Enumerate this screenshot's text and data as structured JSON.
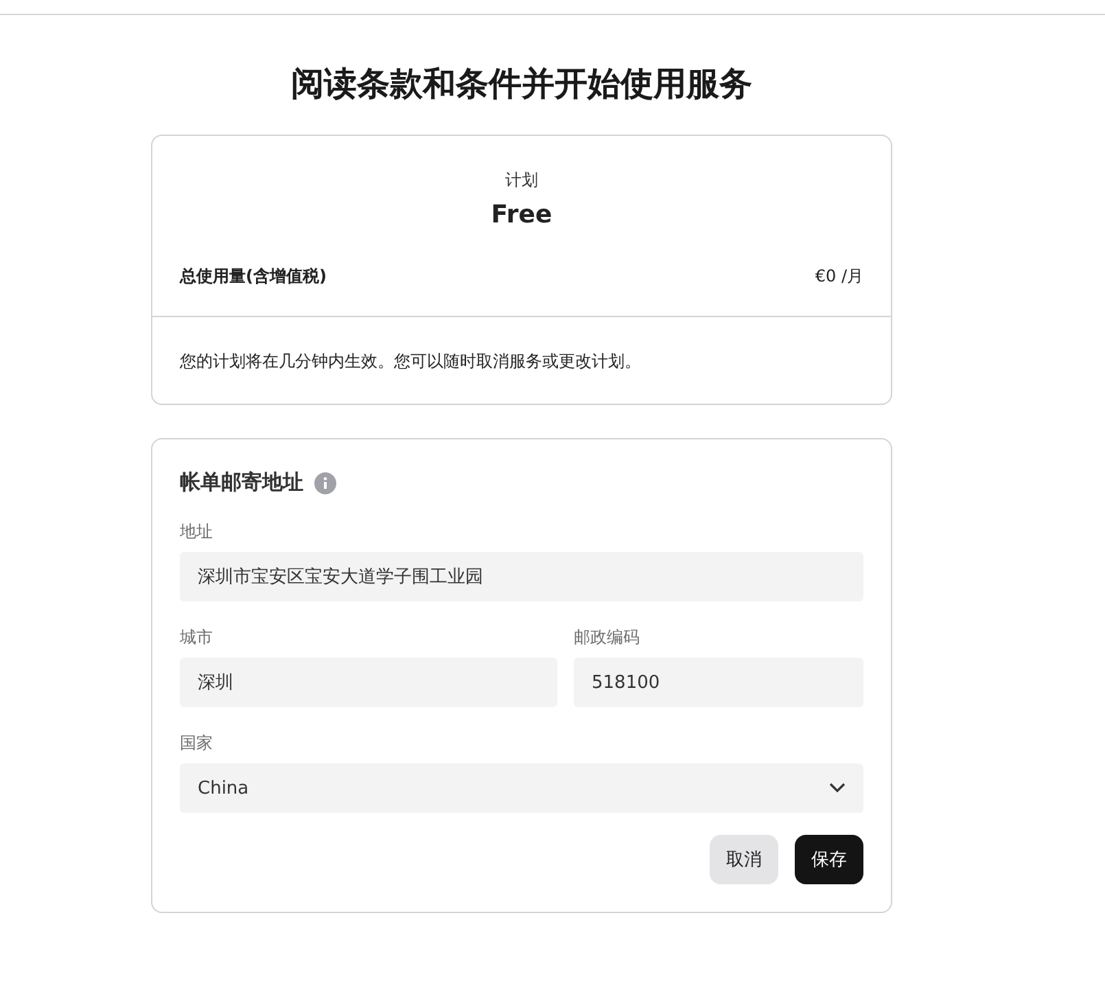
{
  "title": "阅读条款和条件并开始使用服务",
  "plan": {
    "label": "计划",
    "name": "Free",
    "total_label": "总使用量(含增值税)",
    "total_value": "€0 /月",
    "note": "您的计划将在几分钟内生效。您可以随时取消服务或更改计划。"
  },
  "billing": {
    "heading": "帐单邮寄地址",
    "address": {
      "label": "地址",
      "value": "深圳市宝安区宝安大道学子围工业园"
    },
    "city": {
      "label": "城市",
      "value": "深圳"
    },
    "postcode": {
      "label": "邮政编码",
      "value": "518100"
    },
    "country": {
      "label": "国家",
      "value": "China"
    },
    "buttons": [
      {
        "label": "取消",
        "kind": "secondary"
      },
      {
        "label": "保存",
        "kind": "primary"
      }
    ]
  }
}
